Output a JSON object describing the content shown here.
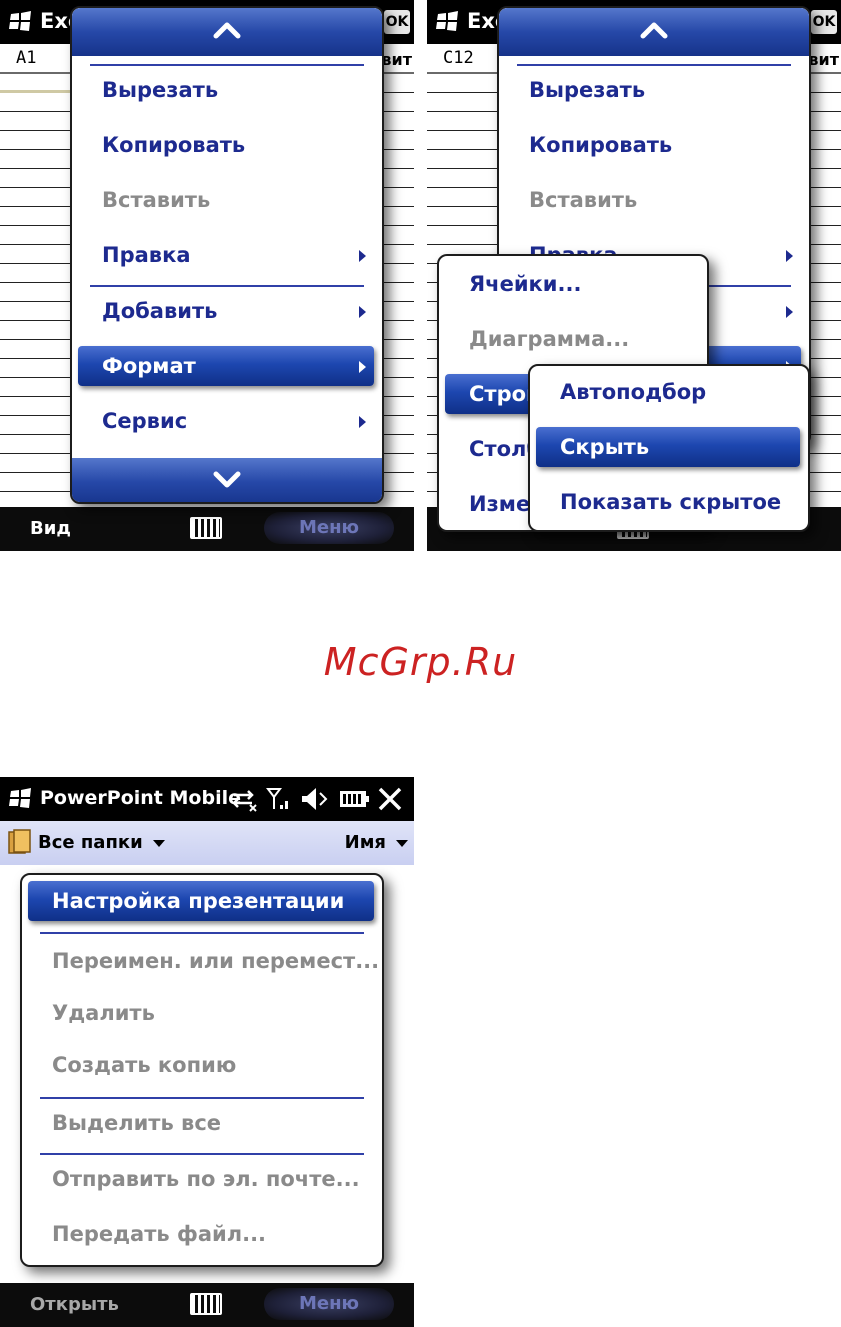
{
  "excel_left": {
    "app_title": "Exc",
    "ok_label": "OK",
    "cell_ref": "A1",
    "cut_off_header": "вит",
    "softkeys": {
      "left": "Вид",
      "right": "Меню"
    },
    "menu": {
      "items": [
        {
          "label": "Вырезать",
          "state": "enabled"
        },
        {
          "label": "Копировать",
          "state": "enabled"
        },
        {
          "label": "Вставить",
          "state": "disabled"
        },
        {
          "label": "Правка",
          "state": "enabled",
          "submenu": true
        },
        {
          "label": "Добавить",
          "state": "enabled",
          "submenu": true
        },
        {
          "label": "Формат",
          "state": "selected",
          "submenu": true
        },
        {
          "label": "Сервис",
          "state": "enabled",
          "submenu": true
        }
      ]
    }
  },
  "excel_right": {
    "app_title": "Exc",
    "ok_label": "OK",
    "cell_ref": "C12",
    "cut_off_header": "вит",
    "menu": {
      "items": [
        {
          "label": "Вырезать",
          "state": "enabled"
        },
        {
          "label": "Копировать",
          "state": "enabled"
        },
        {
          "label": "Вставить",
          "state": "disabled"
        },
        {
          "label": "Правка",
          "state": "enabled",
          "submenu": true
        }
      ]
    },
    "format_submenu": {
      "items": [
        {
          "label": "Ячейки...",
          "state": "enabled"
        },
        {
          "label": "Диаграмма...",
          "state": "disabled"
        },
        {
          "label": "Строк",
          "state": "selected"
        },
        {
          "label": "Столб",
          "state": "enabled"
        },
        {
          "label": "Измен",
          "state": "enabled"
        }
      ]
    },
    "rows_submenu": {
      "items": [
        {
          "label": "Автоподбор",
          "state": "enabled"
        },
        {
          "label": "Скрыть",
          "state": "selected"
        },
        {
          "label": "Показать скрытое",
          "state": "enabled"
        }
      ]
    }
  },
  "watermark": "McGrp.Ru",
  "powerpoint": {
    "app_title": "PowerPoint Mobile",
    "folder_label": "Все папки",
    "sort_label": "Имя",
    "softkeys": {
      "left": "Открыть",
      "right": "Меню"
    },
    "menu": {
      "items": [
        {
          "label": "Настройка презентации",
          "state": "selected"
        },
        {
          "label": "Переимен. или перемест...",
          "state": "disabled"
        },
        {
          "label": "Удалить",
          "state": "disabled"
        },
        {
          "label": "Создать копию",
          "state": "disabled"
        },
        {
          "label": "Выделить все",
          "state": "disabled"
        },
        {
          "label": "Отправить по эл. почте...",
          "state": "disabled"
        },
        {
          "label": "Передать файл...",
          "state": "disabled"
        }
      ]
    }
  },
  "colors": {
    "menu_text": "#1d2a8f",
    "highlight": "#1d47b0",
    "disabled_text": "#8a8a8a",
    "watermark": "#cc2222"
  }
}
